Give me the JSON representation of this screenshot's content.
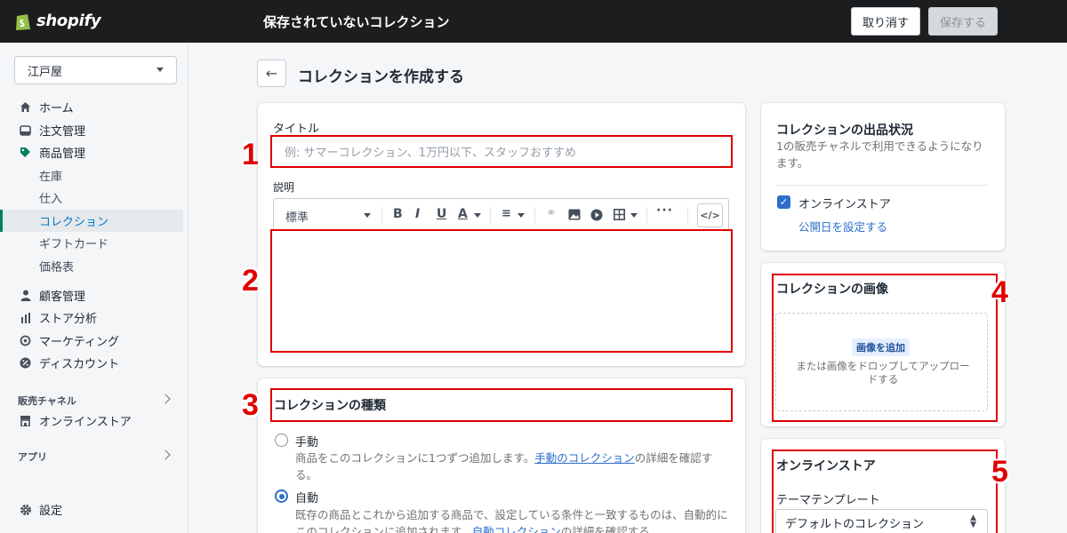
{
  "topbar": {
    "logo_text": "shopify",
    "title": "保存されていないコレクション",
    "discard_label": "取り消す",
    "save_label": "保存する"
  },
  "sidebar": {
    "store_name": "江戸屋",
    "items": [
      {
        "label": "ホーム",
        "icon": "home-icon"
      },
      {
        "label": "注文管理",
        "icon": "inbox-icon"
      },
      {
        "label": "商品管理",
        "icon": "tag-icon"
      },
      {
        "label": "在庫"
      },
      {
        "label": "仕入"
      },
      {
        "label": "コレクション"
      },
      {
        "label": "ギフトカード"
      },
      {
        "label": "価格表"
      },
      {
        "label": "顧客管理",
        "icon": "person-icon"
      },
      {
        "label": "ストア分析",
        "icon": "bar-chart-icon"
      },
      {
        "label": "マーケティング",
        "icon": "target-icon"
      },
      {
        "label": "ディスカウント",
        "icon": "discount-icon"
      }
    ],
    "sales_channels_label": "販売チャネル",
    "online_store_label": "オンラインストア",
    "apps_label": "アプリ",
    "settings_label": "設定"
  },
  "main": {
    "page_title": "コレクションを作成する",
    "title_label": "タイトル",
    "title_placeholder": "例: サマーコレクション、1万円以下、スタッフおすすめ",
    "description_label": "説明",
    "toolbar_format": "標準",
    "collection_type_title": "コレクションの種類",
    "manual_label": "手動",
    "manual_help_pre": "商品をこのコレクションに1つずつ追加します。",
    "manual_help_link": "手動のコレクション",
    "manual_help_post": "の詳細を確認する。",
    "auto_label": "自動",
    "auto_help_line1": "既存の商品とこれから追加する商品で、設定している条件と一致するものは、自動的に",
    "auto_help_pre": "このコレクションに追加されます。",
    "auto_help_link": "自動コレクション",
    "auto_help_post": "の詳細を確認する。"
  },
  "availability": {
    "title": "コレクションの出品状況",
    "description": "1の販売チャネルで利用できるようになります。",
    "channel_label": "オンラインストア",
    "schedule_link": "公開日を設定する"
  },
  "image_card": {
    "title": "コレクションの画像",
    "add_button": "画像を追加",
    "drop_text": "または画像をドロップしてアップロードする"
  },
  "online_store_card": {
    "title": "オンラインストア",
    "template_label": "テーマテンプレート",
    "template_value": "デフォルトのコレクション"
  },
  "annotations": [
    "1",
    "2",
    "3",
    "4",
    "5"
  ],
  "colors": {
    "annotation": "#e00000",
    "link": "#2c6ecb",
    "topbar": "#1c1d1f"
  }
}
